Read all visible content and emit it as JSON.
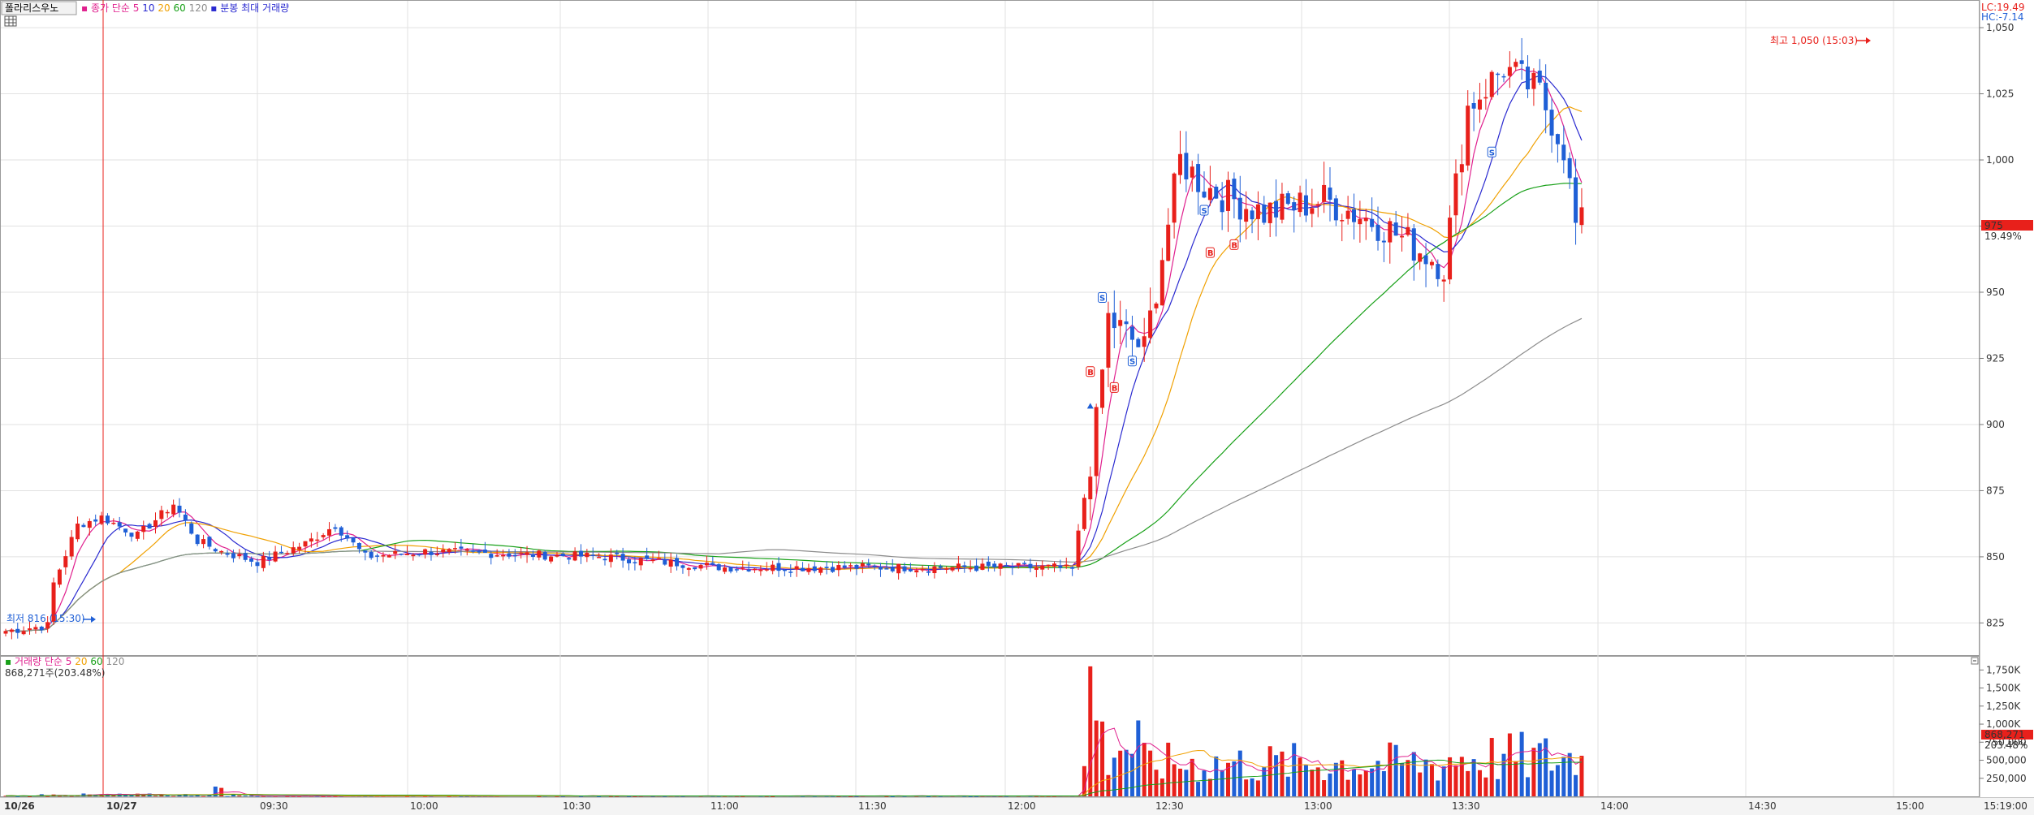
{
  "header": {
    "stock_name": "폴라리스우노",
    "price_legend_prefix": "종가 단순",
    "ma_periods": [
      "5",
      "10",
      "20",
      "60",
      "120"
    ],
    "ma_colors": [
      "#e0208e",
      "#2a2ad0",
      "#f0a000",
      "#18a018",
      "#8c8c8c"
    ],
    "chart_mode": "분봉 최대 거래량"
  },
  "price_axis": {
    "ticks": [
      "1,050",
      "1,025",
      "1,000",
      "975",
      "950",
      "925",
      "900",
      "875",
      "850",
      "825"
    ],
    "lc_label": "LC:19.49",
    "hc_label": "HC:-7.14",
    "current_price": "975",
    "current_change": "19.49%"
  },
  "annotations": {
    "high": "최고 1,050 (15:03)",
    "low": "최저 816 (15:30)"
  },
  "volume_panel": {
    "legend_prefix": "거래량 단순",
    "ma_periods": [
      "5",
      "20",
      "60",
      "120"
    ],
    "ma_colors": [
      "#e0208e",
      "#f0a000",
      "#18a018",
      "#8c8c8c"
    ],
    "current_volume": "868,271주(203.48%)",
    "axis_ticks": [
      "1,750K",
      "1,500K",
      "1,250K",
      "1,000K",
      "750,000",
      "500,000",
      "250,000"
    ],
    "current_value": "868,271",
    "current_pct": "203.48%"
  },
  "time_axis": {
    "labels": [
      "10/26",
      "10/27",
      "09:30",
      "10:00",
      "10:30",
      "11:00",
      "11:30",
      "12:00",
      "12:30",
      "13:00",
      "13:30",
      "14:00",
      "14:30",
      "15:00",
      "15:19:00"
    ]
  },
  "colors": {
    "up": "#e8201b",
    "down": "#1f5fd6",
    "grid": "#e2e2e2",
    "marker": "#e8201b"
  },
  "chart_data": {
    "type": "candlestick",
    "series": [
      {
        "name": "종가",
        "control_points": [
          [
            0,
            822
          ],
          [
            7,
            824
          ],
          [
            8,
            840
          ],
          [
            12,
            862
          ],
          [
            16,
            865
          ],
          [
            22,
            858
          ],
          [
            28,
            870
          ],
          [
            32,
            856
          ],
          [
            36,
            852
          ],
          [
            42,
            848
          ],
          [
            50,
            855
          ],
          [
            55,
            862
          ],
          [
            60,
            850
          ],
          [
            70,
            852
          ],
          [
            100,
            850
          ],
          [
            120,
            846
          ],
          [
            150,
            846
          ],
          [
            175,
            846
          ],
          [
            178,
            845
          ],
          [
            182,
            900
          ],
          [
            184,
            940
          ],
          [
            190,
            928
          ],
          [
            196,
            1000
          ],
          [
            200,
            990
          ],
          [
            210,
            980
          ],
          [
            220,
            985
          ],
          [
            230,
            975
          ],
          [
            240,
            960
          ],
          [
            244,
            1020
          ],
          [
            250,
            1035
          ],
          [
            256,
            1025
          ],
          [
            260,
            1005
          ],
          [
            262,
            975
          ]
        ]
      }
    ],
    "ylim": [
      815,
      1058
    ],
    "annotation_high": 1050,
    "annotation_low": 816
  }
}
